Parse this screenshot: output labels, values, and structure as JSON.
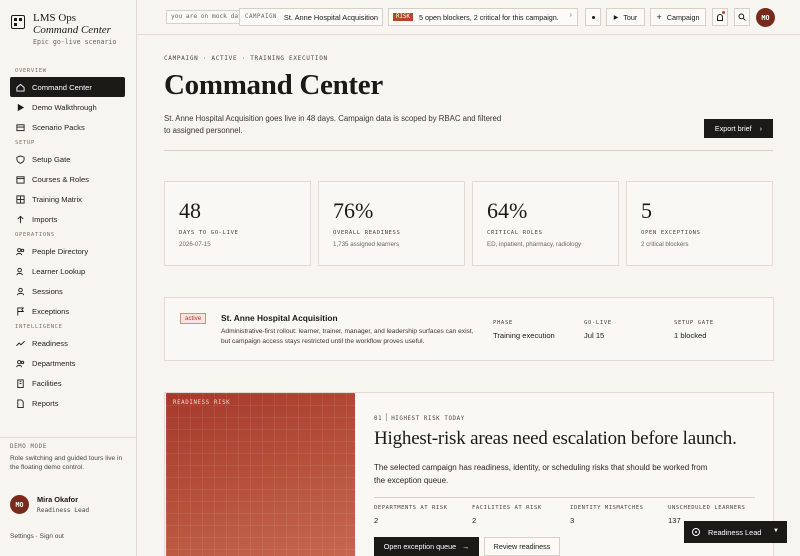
{
  "brand": {
    "title_plain": "LMS Ops ",
    "title_italic": "Command Center",
    "subtitle": "Epic go-live scenario"
  },
  "sidebar": {
    "sections": [
      {
        "label": "OVERVIEW",
        "items": [
          {
            "label": "Command Center",
            "icon": "home-icon",
            "active": true
          },
          {
            "label": "Demo Walkthrough",
            "icon": "play-icon"
          },
          {
            "label": "Scenario Packs",
            "icon": "package-icon"
          }
        ]
      },
      {
        "label": "SETUP",
        "items": [
          {
            "label": "Setup Gate",
            "icon": "shield-icon"
          },
          {
            "label": "Courses & Roles",
            "icon": "calendar-icon"
          },
          {
            "label": "Training Matrix",
            "icon": "grid-icon"
          },
          {
            "label": "Imports",
            "icon": "arrow-up-icon"
          }
        ]
      },
      {
        "label": "OPERATIONS",
        "items": [
          {
            "label": "People Directory",
            "icon": "users-icon"
          },
          {
            "label": "Learner Lookup",
            "icon": "user-search-icon"
          },
          {
            "label": "Sessions",
            "icon": "user-icon"
          },
          {
            "label": "Exceptions",
            "icon": "flag-icon"
          }
        ]
      },
      {
        "label": "INTELLIGENCE",
        "items": [
          {
            "label": "Readiness",
            "icon": "trend-icon"
          },
          {
            "label": "Departments",
            "icon": "users-icon"
          },
          {
            "label": "Facilities",
            "icon": "building-icon"
          },
          {
            "label": "Reports",
            "icon": "file-icon"
          }
        ]
      }
    ],
    "demo_label": "DEMO MODE",
    "demo_text": "Role switching and guided tours live in the floating demo control.",
    "user": {
      "initials": "MO",
      "name": "Mira Okafor",
      "role": "Readiness Lead"
    },
    "footer": "Settings · Sign out"
  },
  "topbar": {
    "search_value": "you are on mock data set",
    "campaign_key": "CAMPAIGN",
    "campaign_value": "St. Anne Hospital Acquisition",
    "risk_tag": "RISK",
    "risk_text": "5 open blockers, 2 critical for this campaign.",
    "tour_label": "Tour",
    "campaign_btn": "Campaign",
    "avatar": "MO"
  },
  "main": {
    "crumb": "CAMPAIGN · ACTIVE · TRAINING EXECUTION",
    "title": "Command Center",
    "desc": "St. Anne Hospital Acquisition goes live in 48 days. Campaign data is scoped by RBAC and filtered to assigned personnel.",
    "export": "Export brief",
    "stats": [
      {
        "value": "48",
        "label": "DAYS TO GO-LIVE",
        "sub": "2026-07-15"
      },
      {
        "value": "76%",
        "label": "OVERALL READINESS",
        "sub": "1,735 assigned learners"
      },
      {
        "value": "64%",
        "label": "CRITICAL ROLES",
        "sub": "ED, inpatient, pharmacy, radiology"
      },
      {
        "value": "5",
        "label": "OPEN EXCEPTIONS",
        "sub": "2 critical blockers"
      }
    ],
    "campaign": {
      "badge": "active",
      "name": "St. Anne Hospital Acquisition",
      "body": "Administrative-first rollout: learner, trainer, manager, and leadership surfaces can exist, but campaign access stays restricted until the workflow proves useful.",
      "phase_k": "PHASE",
      "phase_v": "Training execution",
      "golive_k": "GO-LIVE",
      "golive_v": "Jul 15",
      "gate_k": "SETUP GATE",
      "gate_v": "1 blocked"
    },
    "risk": {
      "image_label": "READINESS RISK",
      "num": "01",
      "eyebrow": "HIGHEST RISK TODAY",
      "title": "Highest-risk areas need escalation before launch.",
      "body": "The selected campaign has readiness, identity, or scheduling risks that should be worked from the exception queue.",
      "stats": [
        {
          "k": "DEPARTMENTS AT RISK",
          "v": "2"
        },
        {
          "k": "FACILITIES AT RISK",
          "v": "2"
        },
        {
          "k": "IDENTITY MISMATCHES",
          "v": "3"
        },
        {
          "k": "UNSCHEDULED LEARNERS",
          "v": "137"
        }
      ],
      "primary": "Open exception queue",
      "secondary": "Review readiness"
    }
  },
  "floater": {
    "label": "Readiness Lead"
  },
  "colors": {
    "accent": "#b5452c",
    "dark": "#1c1a17",
    "background": "#f7f5f0"
  }
}
